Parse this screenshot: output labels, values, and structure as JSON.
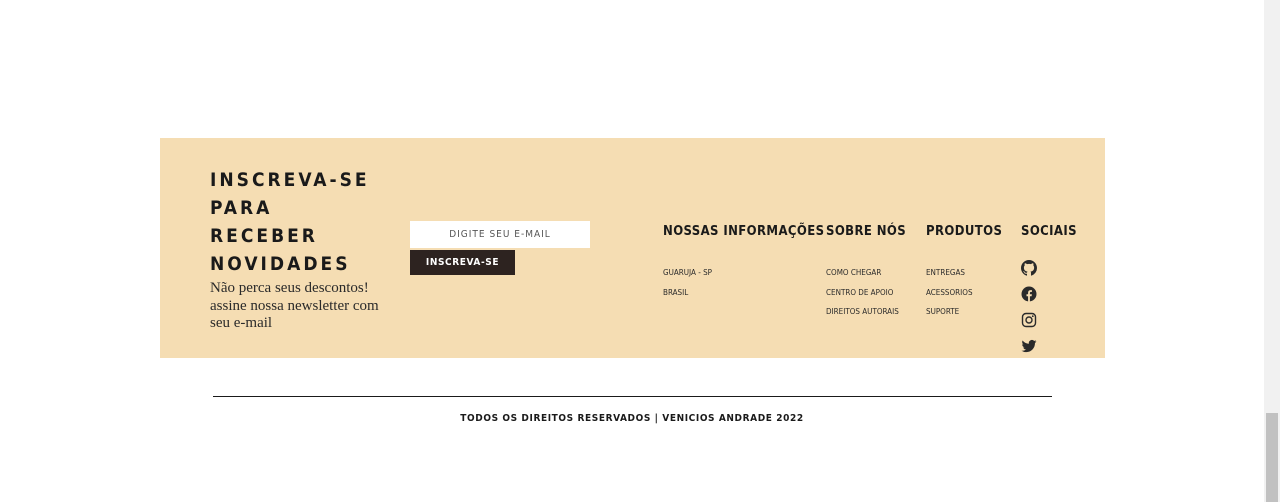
{
  "newsletter": {
    "title_line1": "INSCREVA-SE PARA",
    "title_line2": "RECEBER",
    "title_line3": "NOVIDADES",
    "description": "Não perca seus descontos! assine nossa newsletter com seu e-mail",
    "email_placeholder": "DIGITE SEU E-MAIL",
    "subscribe_label": "INSCREVA-SE"
  },
  "columns": {
    "info": {
      "heading": "NOSSAS INFORMAÇÕES",
      "items": [
        "GUARUJA - SP",
        "BRASIL"
      ]
    },
    "about": {
      "heading": "SOBRE NÓS",
      "items": [
        "COMO CHEGAR",
        "CENTRO DE APOIO",
        "DIREITOS AUTORAIS"
      ]
    },
    "products": {
      "heading": "PRODUTOS",
      "items": [
        "ENTREGAS",
        "ACESSORIOS",
        "SUPORTE"
      ]
    },
    "social": {
      "heading": "SOCIAIS",
      "icons": [
        "github-icon",
        "facebook-icon",
        "instagram-icon",
        "twitter-icon"
      ]
    }
  },
  "copyright": "TODOS OS DIREITOS RESERVADOS | VENICIOS ANDRADE 2022",
  "colors": {
    "footer_background": "#f5ddb3",
    "button_background": "#2d2320",
    "text": "#1a1a1a"
  }
}
